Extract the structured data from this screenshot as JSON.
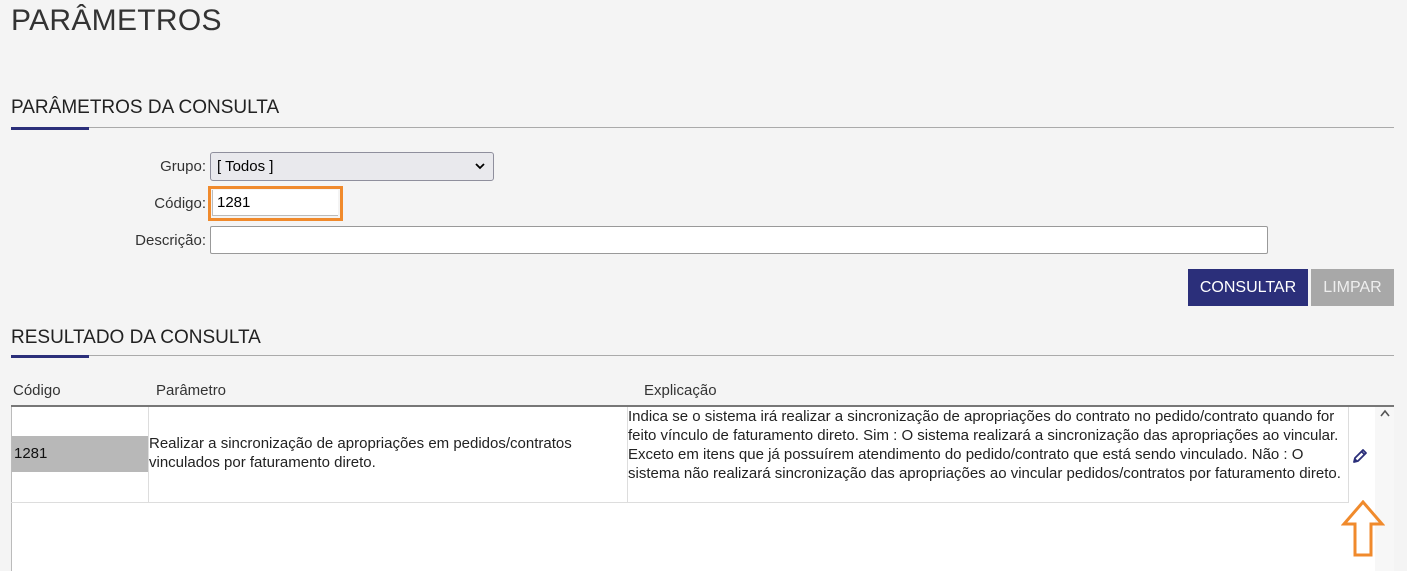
{
  "page": {
    "title": "PARÂMETROS"
  },
  "query_section": {
    "title": "PARÂMETROS DA CONSULTA",
    "group_label": "Grupo:",
    "group_value": "[ Todos ]",
    "code_label": "Código:",
    "code_value": "1281",
    "description_label": "Descrição:",
    "description_value": "",
    "consult_button": "CONSULTAR",
    "clear_button": "LIMPAR"
  },
  "result_section": {
    "title": "RESULTADO DA CONSULTA",
    "columns": [
      "Código",
      "Parâmetro",
      "Explicação"
    ],
    "rows": [
      {
        "code": "1281",
        "parameter": "Realizar a sincronização de apropriações em pedidos/contratos vinculados por faturamento direto.",
        "explanation": "Indica se o sistema irá realizar a sincronização de apropriações do contrato no pedido/contrato quando for feito vínculo de faturamento direto. Sim : O sistema realizará a sincronização das apropriações ao vincular. Exceto em itens que já possuírem atendimento do pedido/contrato que está sendo vinculado. Não : O sistema não realizará sincronização das apropriações ao vincular pedidos/contratos por faturamento direto."
      }
    ]
  },
  "icons": {
    "edit": "pencil-icon",
    "select_arrow": "chevron-down-icon",
    "scroll_up": "chevron-up-icon",
    "highlight_arrow": "arrow-up-icon"
  },
  "colors": {
    "accent": "#2b2f7a",
    "highlight": "#f08a2c",
    "disabled_button": "#a8a8a8"
  }
}
